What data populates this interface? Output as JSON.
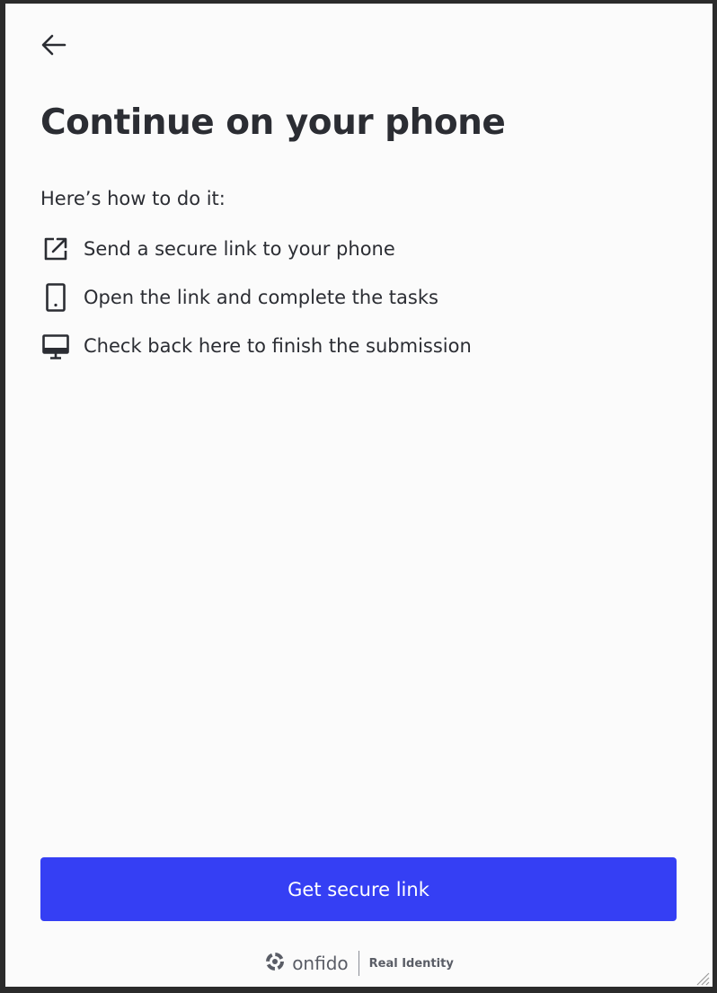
{
  "header": {
    "back_icon": "arrow-left-icon",
    "title": "Continue on your phone"
  },
  "intro": "Here’s how to do it:",
  "steps": [
    {
      "icon": "external-link-icon",
      "label": "Send a secure link to your phone"
    },
    {
      "icon": "smartphone-icon",
      "label": "Open the link and complete the tasks"
    },
    {
      "icon": "desktop-monitor-icon",
      "label": "Check back here to finish the submission"
    }
  ],
  "actions": {
    "primary_label": "Get secure link"
  },
  "footer": {
    "brand": "onfido",
    "tagline": "Real Identity"
  },
  "colors": {
    "accent": "#353ff4",
    "text": "#2b2d33",
    "background": "#fbfbfb"
  }
}
